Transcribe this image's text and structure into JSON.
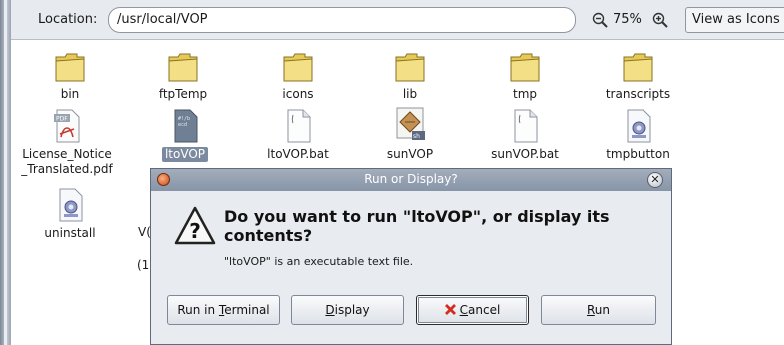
{
  "toolbar": {
    "location_label": "Location:",
    "location_path": "/usr/local/VOP",
    "zoom_level": "75%",
    "view_mode": "View as Icons"
  },
  "files": [
    {
      "name": "bin",
      "type": "folder"
    },
    {
      "name": "ftpTemp",
      "type": "folder"
    },
    {
      "name": "icons",
      "type": "folder"
    },
    {
      "name": "lib",
      "type": "folder"
    },
    {
      "name": "tmp",
      "type": "folder"
    },
    {
      "name": "transcripts",
      "type": "folder"
    },
    {
      "name_line1": "License_Notice",
      "name_line2": "_Translated.pdf",
      "type": "pdf"
    },
    {
      "name": "ltoVOP",
      "type": "executable-script",
      "selected": true
    },
    {
      "name": "ltoVOP.bat",
      "type": "text"
    },
    {
      "name": "sunVOP",
      "type": "shell-script"
    },
    {
      "name": "sunVOP.bat",
      "type": "text"
    },
    {
      "name": "tmpbutton",
      "type": "binary"
    },
    {
      "name": "uninstall",
      "type": "binary"
    }
  ],
  "obscured_fragments": {
    "row3_name_prefix": "V(",
    "row3_size_prefix": "(1"
  },
  "dialog": {
    "title": "Run or Display?",
    "heading": "Do you want to run \"ltoVOP\", or display its contents?",
    "description": "\"ltoVOP\" is an executable text file.",
    "buttons": {
      "run_in_terminal_prefix": "Run in ",
      "run_in_terminal_mnemonic": "T",
      "run_in_terminal_suffix": "erminal",
      "display_mnemonic": "D",
      "display_suffix": "isplay",
      "cancel_mnemonic": "C",
      "cancel_suffix": "ancel",
      "run_mnemonic": "R",
      "run_suffix": "un"
    }
  },
  "colors": {
    "folder": "#f0d978",
    "selection": "#7b8a9f",
    "titlebar": "#8795a8",
    "cancel_x": "#d42b1f"
  }
}
